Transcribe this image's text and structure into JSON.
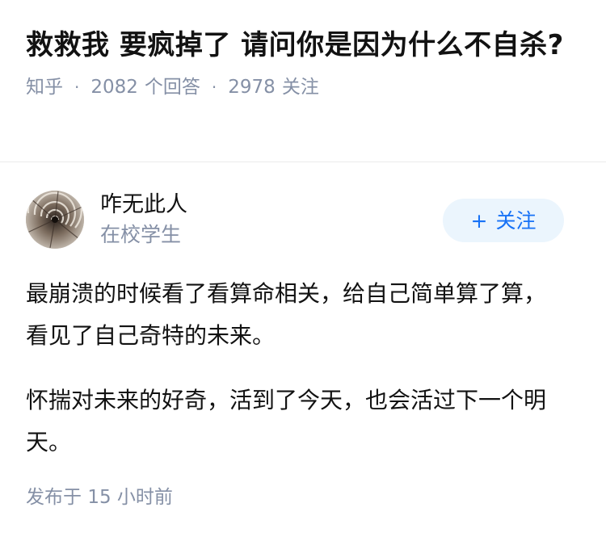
{
  "question": {
    "title": "救救我 要疯掉了 请问你是因为什么不自杀?",
    "source": "知乎",
    "answer_count": "2082",
    "answer_count_label": "个回答",
    "follower_count": "2978",
    "follower_count_label": "关注"
  },
  "answer": {
    "author": {
      "name": "咋无此人",
      "headline": "在校学生",
      "avatar_icon": "spiral-staircase-avatar"
    },
    "follow_button": {
      "icon": "+",
      "label": "关注"
    },
    "paragraphs": [
      "最崩溃的时候看了看算命相关，给自己简单算了算，看见了自己奇特的未来。",
      "怀揣对未来的好奇，活到了今天，也会活过下一个明天。"
    ],
    "published_label": "发布于",
    "published_time": "15 小时前"
  },
  "colors": {
    "text_primary": "#121212",
    "text_secondary": "#8590a6",
    "brand_blue": "#1772f6",
    "follow_bg": "#ebf5fd",
    "divider": "#ebebeb"
  }
}
